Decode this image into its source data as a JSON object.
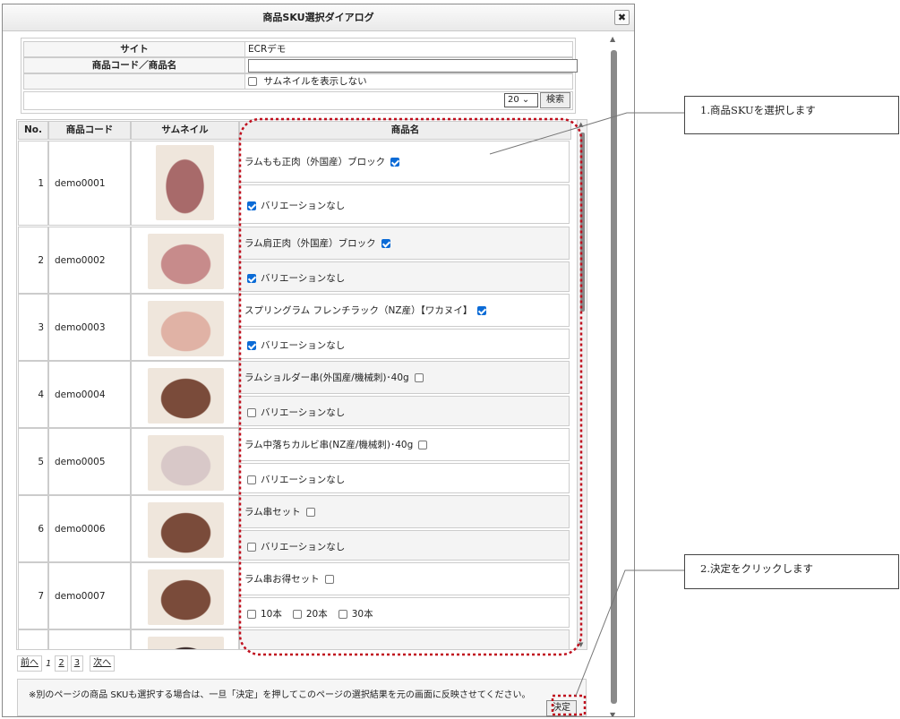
{
  "dialog": {
    "title": "商品SKU選択ダイアログ",
    "close_glyph": "✖"
  },
  "search": {
    "site_label": "サイト",
    "site_value": "ECRデモ",
    "keyword_label": "商品コード／商品名",
    "keyword_value": "",
    "hide_thumbnail_label": "サムネイルを表示しない",
    "page_size": "20 ⌄",
    "search_button": "検索"
  },
  "table": {
    "headers": [
      "No.",
      "商品コード",
      "サムネイル",
      "商品名"
    ],
    "rows": [
      {
        "no": "1",
        "code": "demo0001",
        "name": "ラムもも正肉（外国産）ブロック",
        "checked": true,
        "variants": [
          {
            "label": "バリエーションなし",
            "checked": true
          }
        ],
        "thumb_color": "#a86a6a"
      },
      {
        "no": "2",
        "code": "demo0002",
        "name": "ラム肩正肉（外国産）ブロック",
        "checked": true,
        "variants": [
          {
            "label": "バリエーションなし",
            "checked": true
          }
        ],
        "thumb_color": "#c78b8b"
      },
      {
        "no": "3",
        "code": "demo0003",
        "name": "スプリングラム フレンチラック（NZ産）【ワカヌイ】",
        "checked": true,
        "variants": [
          {
            "label": "バリエーションなし",
            "checked": true
          }
        ],
        "thumb_color": "#e0b2a5"
      },
      {
        "no": "4",
        "code": "demo0004",
        "name": "ラムショルダー串(外国産/機械刺)･40g",
        "checked": false,
        "variants": [
          {
            "label": "バリエーションなし",
            "checked": false
          }
        ],
        "thumb_color": "#7a4b3a"
      },
      {
        "no": "5",
        "code": "demo0005",
        "name": "ラム中落ちカルビ串(NZ産/機械刺)･40g",
        "checked": false,
        "variants": [
          {
            "label": "バリエーションなし",
            "checked": false
          }
        ],
        "thumb_color": "#d8c8c8"
      },
      {
        "no": "6",
        "code": "demo0006",
        "name": "ラム串セット",
        "checked": false,
        "variants": [
          {
            "label": "バリエーションなし",
            "checked": false
          }
        ],
        "thumb_color": "#7a4b3a"
      },
      {
        "no": "7",
        "code": "demo0007",
        "name": "ラム串お得セット",
        "checked": false,
        "variants": [
          {
            "label": "10本",
            "checked": false
          },
          {
            "label": "20本",
            "checked": false
          },
          {
            "label": "30本",
            "checked": false
          }
        ],
        "thumb_color": "#7a4b3a"
      },
      {
        "no": "",
        "code": "",
        "name": "",
        "checked": false,
        "variants": [],
        "thumb_color": "#3a2a2a"
      }
    ]
  },
  "pager": {
    "prev": "前へ",
    "current": "1",
    "pages": [
      "2",
      "3"
    ],
    "next": "次へ"
  },
  "notice": {
    "text": "※別のページの商品 SKUも選択する場合は、一旦「決定」を押してこのページの選択結果を元の画面に反映させてください。",
    "decide_button": "決定"
  },
  "callouts": {
    "step1": "1.商品SKUを選択します",
    "step2": "2.決定をクリックします"
  },
  "colors": {
    "annotation_red": "#c0101e",
    "checkbox_blue": "#0b6bd6"
  }
}
